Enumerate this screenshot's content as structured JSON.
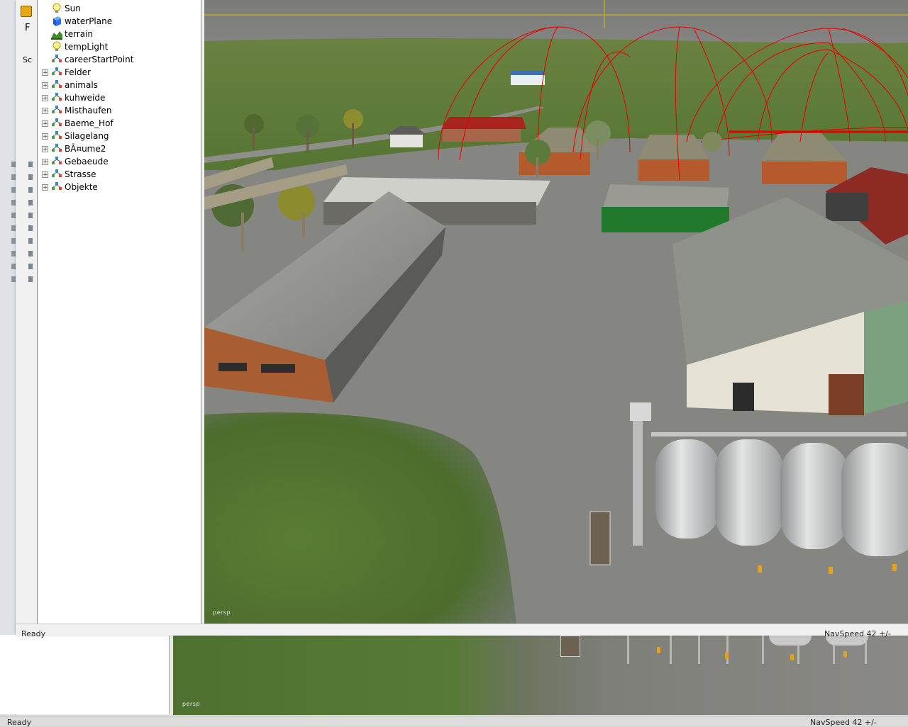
{
  "window": {
    "menu_first_letter": "F",
    "side_label": "Sc"
  },
  "scenegraph": {
    "items": [
      {
        "label": "Sun",
        "icon": "light-bulb-icon",
        "expandable": false
      },
      {
        "label": "waterPlane",
        "icon": "water-cube-icon",
        "expandable": false
      },
      {
        "label": "terrain",
        "icon": "terrain-icon",
        "expandable": false
      },
      {
        "label": "tempLight",
        "icon": "light-bulb-icon",
        "expandable": false
      },
      {
        "label": "careerStartPoint",
        "icon": "transform-group-icon",
        "expandable": false
      },
      {
        "label": "Felder",
        "icon": "transform-group-icon",
        "expandable": true
      },
      {
        "label": "animals",
        "icon": "transform-group-icon",
        "expandable": true
      },
      {
        "label": "kuhweide",
        "icon": "transform-group-icon",
        "expandable": true
      },
      {
        "label": "Misthaufen",
        "icon": "transform-group-icon",
        "expandable": true
      },
      {
        "label": "Baeme_Hof",
        "icon": "transform-group-icon",
        "expandable": true
      },
      {
        "label": "Silagelang",
        "icon": "transform-group-icon",
        "expandable": true
      },
      {
        "label": "BÃ¤ume2",
        "icon": "transform-group-icon",
        "expandable": true
      },
      {
        "label": "Gebaeude",
        "icon": "transform-group-icon",
        "expandable": true
      },
      {
        "label": "Strasse",
        "icon": "transform-group-icon",
        "expandable": true
      },
      {
        "label": "Objekte",
        "icon": "transform-group-icon",
        "expandable": true
      }
    ]
  },
  "viewport": {
    "camera_label": "persp"
  },
  "statusbar": {
    "status": "Ready",
    "navspeed": "NavSpeed 42 +/-"
  },
  "background_window": {
    "camera_label": "persp",
    "status": "Ready",
    "navspeed": "NavSpeed 42 +/-"
  },
  "colors": {
    "grass": "#5d7f3a",
    "gravel": "#8a8a86",
    "gizmo_red": "#e60000",
    "sky": "#7c7c7b"
  }
}
